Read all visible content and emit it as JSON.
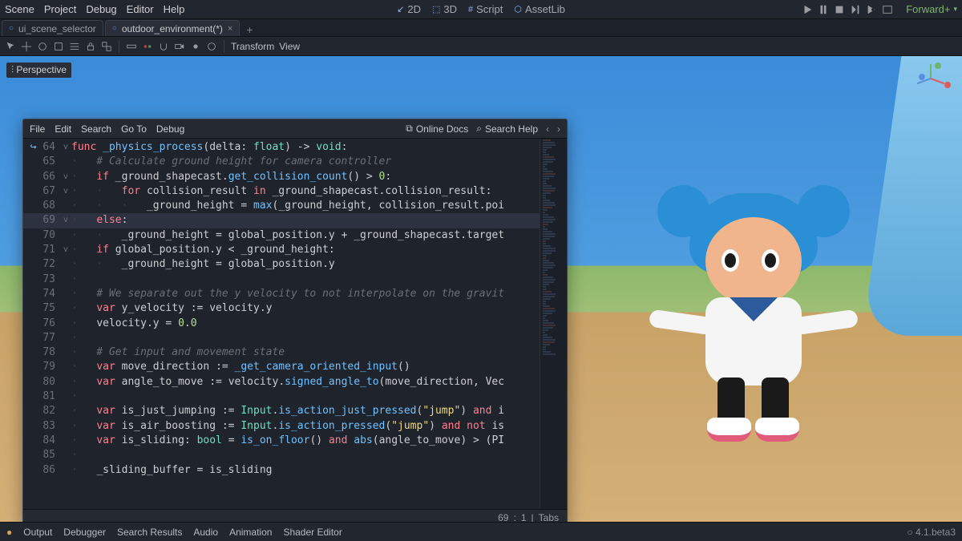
{
  "menubar": [
    "Scene",
    "Project",
    "Debug",
    "Editor",
    "Help"
  ],
  "workspace_tabs": [
    {
      "glyph": "↙",
      "label": "2D"
    },
    {
      "glyph": "⬚",
      "label": "3D"
    },
    {
      "glyph": "#",
      "label": "Script"
    },
    {
      "glyph": "⬡",
      "label": "AssetLib"
    }
  ],
  "render_mode": "Forward+",
  "scene_tabs": [
    {
      "icon": "○",
      "label": "ui_scene_selector",
      "active": false,
      "closable": false
    },
    {
      "icon": "○",
      "label": "outdoor_environment(*)",
      "active": true,
      "closable": true
    }
  ],
  "tool_labels": {
    "transform": "Transform",
    "view": "View"
  },
  "perspective_badge": "⫶ Perspective",
  "script_menu": {
    "left": [
      "File",
      "Edit",
      "Search",
      "Go To",
      "Debug"
    ],
    "right": [
      {
        "icon": "⧉",
        "label": "Online Docs"
      },
      {
        "icon": "⌕",
        "label": "Search Help"
      }
    ],
    "nav": [
      "‹",
      "›"
    ]
  },
  "code": {
    "first_line": 64,
    "highlight_line": 69,
    "def_icon": "↪",
    "lines": [
      {
        "n": 64,
        "fold": "v",
        "i": 0,
        "seg": [
          [
            "kw",
            "func "
          ],
          [
            "fn",
            "_physics_process"
          ],
          [
            "op",
            "("
          ],
          [
            "id",
            "delta"
          ],
          [
            "op",
            ": "
          ],
          [
            "ty",
            "float"
          ],
          [
            "op",
            ") -> "
          ],
          [
            "ty",
            "void"
          ],
          [
            "op",
            ":"
          ]
        ]
      },
      {
        "n": 65,
        "fold": "",
        "i": 1,
        "seg": [
          [
            "cm",
            "# Calculate ground height for camera controller"
          ]
        ]
      },
      {
        "n": 66,
        "fold": "v",
        "i": 1,
        "seg": [
          [
            "kw",
            "if "
          ],
          [
            "id",
            "_ground_shapecast"
          ],
          [
            "op",
            "."
          ],
          [
            "mem",
            "get_collision_count"
          ],
          [
            "op",
            "() > "
          ],
          [
            "num",
            "0"
          ],
          [
            "op",
            ":"
          ]
        ]
      },
      {
        "n": 67,
        "fold": "v",
        "i": 2,
        "seg": [
          [
            "kw",
            "for "
          ],
          [
            "id",
            "collision_result"
          ],
          [
            "kw",
            " in "
          ],
          [
            "id",
            "_ground_shapecast"
          ],
          [
            "op",
            "."
          ],
          [
            "id",
            "collision_result"
          ],
          [
            "op",
            ":"
          ]
        ]
      },
      {
        "n": 68,
        "fold": "",
        "i": 3,
        "seg": [
          [
            "id",
            "_ground_height"
          ],
          [
            "op",
            " = "
          ],
          [
            "fn",
            "max"
          ],
          [
            "op",
            "("
          ],
          [
            "id",
            "_ground_height"
          ],
          [
            "op",
            ", "
          ],
          [
            "id",
            "collision_result"
          ],
          [
            "op",
            "."
          ],
          [
            "id",
            "poi"
          ]
        ]
      },
      {
        "n": 69,
        "fold": "v",
        "i": 1,
        "seg": [
          [
            "kw",
            "else"
          ],
          [
            "op",
            ":"
          ]
        ]
      },
      {
        "n": 70,
        "fold": "",
        "i": 2,
        "seg": [
          [
            "id",
            "_ground_height"
          ],
          [
            "op",
            " = "
          ],
          [
            "id",
            "global_position"
          ],
          [
            "op",
            "."
          ],
          [
            "id",
            "y"
          ],
          [
            "op",
            " + "
          ],
          [
            "id",
            "_ground_shapecast"
          ],
          [
            "op",
            "."
          ],
          [
            "id",
            "target"
          ]
        ]
      },
      {
        "n": 71,
        "fold": "v",
        "i": 1,
        "seg": [
          [
            "kw",
            "if "
          ],
          [
            "id",
            "global_position"
          ],
          [
            "op",
            "."
          ],
          [
            "id",
            "y"
          ],
          [
            "op",
            " < "
          ],
          [
            "id",
            "_ground_height"
          ],
          [
            "op",
            ":"
          ]
        ]
      },
      {
        "n": 72,
        "fold": "",
        "i": 2,
        "seg": [
          [
            "id",
            "_ground_height"
          ],
          [
            "op",
            " = "
          ],
          [
            "id",
            "global_position"
          ],
          [
            "op",
            "."
          ],
          [
            "id",
            "y"
          ]
        ]
      },
      {
        "n": 73,
        "fold": "",
        "i": 1,
        "seg": []
      },
      {
        "n": 74,
        "fold": "",
        "i": 1,
        "seg": [
          [
            "cm",
            "# We separate out the y velocity to not interpolate on the gravit"
          ]
        ]
      },
      {
        "n": 75,
        "fold": "",
        "i": 1,
        "seg": [
          [
            "kw",
            "var "
          ],
          [
            "id",
            "y_velocity"
          ],
          [
            "op",
            " := "
          ],
          [
            "id",
            "velocity"
          ],
          [
            "op",
            "."
          ],
          [
            "id",
            "y"
          ]
        ]
      },
      {
        "n": 76,
        "fold": "",
        "i": 1,
        "seg": [
          [
            "id",
            "velocity"
          ],
          [
            "op",
            "."
          ],
          [
            "id",
            "y"
          ],
          [
            "op",
            " = "
          ],
          [
            "num",
            "0.0"
          ]
        ]
      },
      {
        "n": 77,
        "fold": "",
        "i": 1,
        "seg": []
      },
      {
        "n": 78,
        "fold": "",
        "i": 1,
        "seg": [
          [
            "cm",
            "# Get input and movement state"
          ]
        ]
      },
      {
        "n": 79,
        "fold": "",
        "i": 1,
        "seg": [
          [
            "kw",
            "var "
          ],
          [
            "id",
            "move_direction"
          ],
          [
            "op",
            " := "
          ],
          [
            "fn",
            "_get_camera_oriented_input"
          ],
          [
            "op",
            "()"
          ]
        ]
      },
      {
        "n": 80,
        "fold": "",
        "i": 1,
        "seg": [
          [
            "kw",
            "var "
          ],
          [
            "id",
            "angle_to_move"
          ],
          [
            "op",
            " := "
          ],
          [
            "id",
            "velocity"
          ],
          [
            "op",
            "."
          ],
          [
            "mem",
            "signed_angle_to"
          ],
          [
            "op",
            "("
          ],
          [
            "id",
            "move_direction"
          ],
          [
            "op",
            ", "
          ],
          [
            "id",
            "Vec"
          ]
        ]
      },
      {
        "n": 81,
        "fold": "",
        "i": 1,
        "seg": []
      },
      {
        "n": 82,
        "fold": "",
        "i": 1,
        "seg": [
          [
            "kw",
            "var "
          ],
          [
            "id",
            "is_just_jumping"
          ],
          [
            "op",
            " := "
          ],
          [
            "ty",
            "Input"
          ],
          [
            "op",
            "."
          ],
          [
            "mem",
            "is_action_just_pressed"
          ],
          [
            "op",
            "("
          ],
          [
            "str",
            "\"jump\""
          ],
          [
            "op",
            ") "
          ],
          [
            "kw",
            "and"
          ],
          [
            "op",
            " i"
          ]
        ]
      },
      {
        "n": 83,
        "fold": "",
        "i": 1,
        "seg": [
          [
            "kw",
            "var "
          ],
          [
            "id",
            "is_air_boosting"
          ],
          [
            "op",
            " := "
          ],
          [
            "ty",
            "Input"
          ],
          [
            "op",
            "."
          ],
          [
            "mem",
            "is_action_pressed"
          ],
          [
            "op",
            "("
          ],
          [
            "str",
            "\"jump\""
          ],
          [
            "op",
            ") "
          ],
          [
            "kw",
            "and not"
          ],
          [
            "op",
            " is"
          ]
        ]
      },
      {
        "n": 84,
        "fold": "",
        "i": 1,
        "seg": [
          [
            "kw",
            "var "
          ],
          [
            "id",
            "is_sliding"
          ],
          [
            "op",
            ": "
          ],
          [
            "ty",
            "bool"
          ],
          [
            "op",
            " = "
          ],
          [
            "fn",
            "is_on_floor"
          ],
          [
            "op",
            "() "
          ],
          [
            "kw",
            "and"
          ],
          [
            "op",
            " "
          ],
          [
            "fn",
            "abs"
          ],
          [
            "op",
            "("
          ],
          [
            "id",
            "angle_to_move"
          ],
          [
            "op",
            ") > ("
          ],
          [
            "id",
            "PI"
          ]
        ]
      },
      {
        "n": 85,
        "fold": "",
        "i": 1,
        "seg": []
      },
      {
        "n": 86,
        "fold": "",
        "i": 1,
        "seg": [
          [
            "id",
            "_sliding_buffer"
          ],
          [
            "op",
            " = "
          ],
          [
            "id",
            "is_sliding"
          ]
        ]
      }
    ]
  },
  "status": {
    "line": 69,
    "col": 1,
    "indent": "Tabs"
  },
  "bottom_panels": [
    "Output",
    "Debugger",
    "Search Results",
    "Audio",
    "Animation",
    "Shader Editor"
  ],
  "version": "4.1.beta3"
}
